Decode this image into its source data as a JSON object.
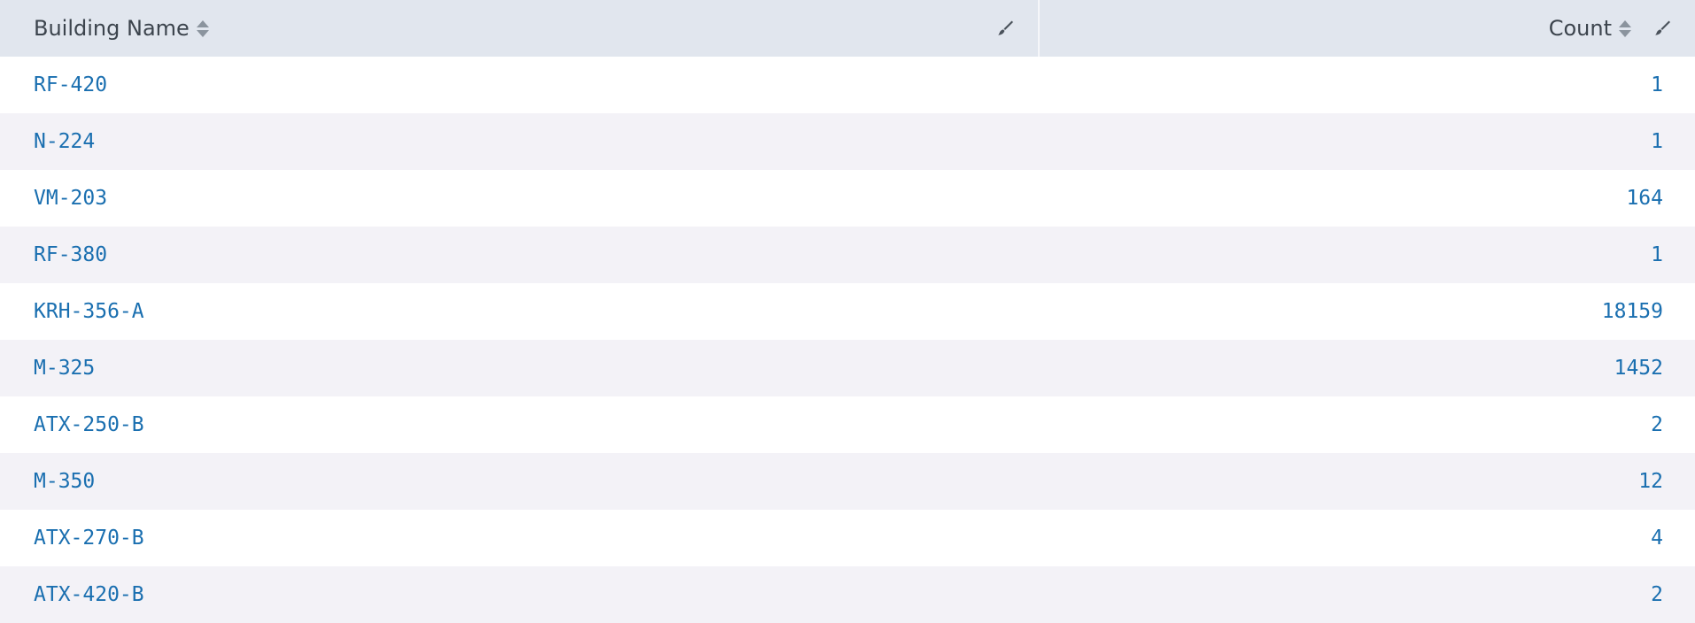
{
  "table": {
    "columns": [
      {
        "label": "Building Name",
        "sort_icon": "sort-icon",
        "format_icon": "brush-icon"
      },
      {
        "label": "Count",
        "sort_icon": "sort-icon",
        "format_icon": "brush-icon"
      }
    ],
    "rows": [
      {
        "name": "RF-420",
        "count": "1"
      },
      {
        "name": "N-224",
        "count": "1"
      },
      {
        "name": "VM-203",
        "count": "164"
      },
      {
        "name": "RF-380",
        "count": "1"
      },
      {
        "name": "KRH-356-A",
        "count": "18159"
      },
      {
        "name": "M-325",
        "count": "1452"
      },
      {
        "name": "ATX-250-B",
        "count": "2"
      },
      {
        "name": "M-350",
        "count": "12"
      },
      {
        "name": "ATX-270-B",
        "count": "4"
      },
      {
        "name": "ATX-420-B",
        "count": "2"
      }
    ]
  },
  "colors": {
    "header_bg": "#e1e6ee",
    "header_text": "#3c444d",
    "link_text": "#1a6fb0",
    "row_alt_bg": "#f3f2f7",
    "row_bg": "#ffffff"
  }
}
